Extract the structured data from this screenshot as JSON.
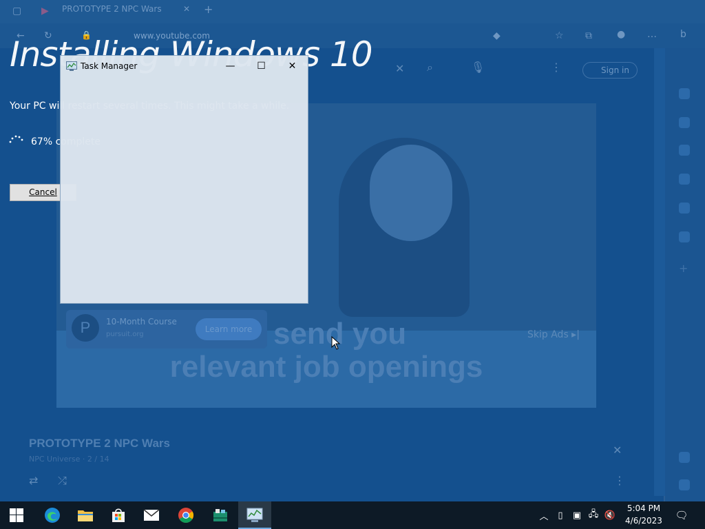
{
  "browser": {
    "tab_title": "PROTOTYPE 2 NPC Wars",
    "url": "www.youtube.com",
    "signin": "Sign in"
  },
  "video": {
    "caption_line1": "d send you",
    "caption_line2": "relevant job openings",
    "ad": {
      "logo_letter": "P",
      "title": "10-Month Course",
      "subtitle": "pursuit.org",
      "button": "Learn more"
    },
    "skip": "Skip Ads ▸|",
    "title": "PROTOTYPE 2 NPC Wars",
    "subtitle": "NPC Universe · 2 / 14"
  },
  "setup": {
    "title": "Installing Windows 10",
    "message": "Your PC will restart several times. This might take a while.",
    "progress_text": "67% complete",
    "progress_percent": 67,
    "cancel_label": "Cancel"
  },
  "task_manager": {
    "title": "Task Manager",
    "minimize_glyph": "—",
    "maximize_glyph": "☐",
    "close_glyph": "✕"
  },
  "taskbar": {
    "pinned": [
      "start",
      "edge",
      "file-explorer",
      "microsoft-store",
      "mail",
      "chrome",
      "installer",
      "task-manager"
    ],
    "active": "task-manager",
    "time": "5:04 PM",
    "date": "4/6/2023",
    "tray": [
      "chevron-up",
      "tablet",
      "camera",
      "network",
      "volume-muted",
      "notifications"
    ]
  },
  "colors": {
    "overlay_blue": "#0f4f8f",
    "taskbar": "#0d1a26",
    "window_face": "#dde6ef"
  }
}
